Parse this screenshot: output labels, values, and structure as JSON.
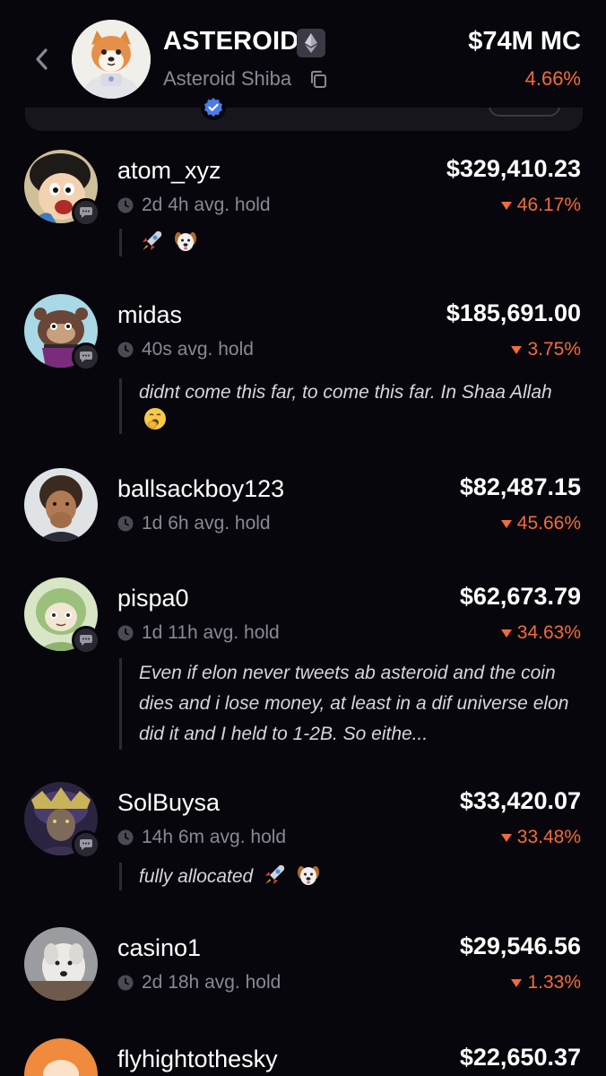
{
  "header": {
    "token_symbol": "ASTEROID",
    "token_name": "Asteroid Shiba",
    "market_cap": "$74M MC",
    "change": "4.66%",
    "chain_icon": "ethereum-icon"
  },
  "holders": [
    {
      "name": "atom_xyz",
      "value": "$329,410.23",
      "change": "46.17%",
      "hold": "2d 4h avg. hold",
      "comment": "",
      "emojis": [
        "rocket-emoji",
        "dog-face-emoji"
      ]
    },
    {
      "name": "midas",
      "value": "$185,691.00",
      "change": "3.75%",
      "hold": "40s avg. hold",
      "comment": "didnt come this far, to come this far. In Shaa Allah",
      "emojis": [
        "yawning-face-emoji"
      ]
    },
    {
      "name": "ballsackboy123",
      "value": "$82,487.15",
      "change": "45.66%",
      "hold": "1d 6h avg. hold",
      "comment": ""
    },
    {
      "name": "pispa0",
      "value": "$62,673.79",
      "change": "34.63%",
      "hold": "1d 11h avg. hold",
      "comment": "Even if elon never tweets ab asteroid and the coin dies and i lose money, at least in a dif universe elon did it and I held to 1-2B. So eithe..."
    },
    {
      "name": "SolBuysa",
      "value": "$33,420.07",
      "change": "33.48%",
      "hold": "14h 6m avg. hold",
      "comment": "fully allocated",
      "emojis": [
        "rocket-emoji",
        "dog-face-emoji"
      ]
    },
    {
      "name": "casino1",
      "value": "$29,546.56",
      "change": "1.33%",
      "hold": "2d 18h avg. hold",
      "comment": ""
    },
    {
      "name": "flyhightothesky",
      "value": "$22,650.37",
      "change": "",
      "hold": "",
      "comment": ""
    }
  ],
  "colors": {
    "background": "#07060c",
    "negative": "#f26b3a",
    "muted_text": "#8a8894"
  }
}
